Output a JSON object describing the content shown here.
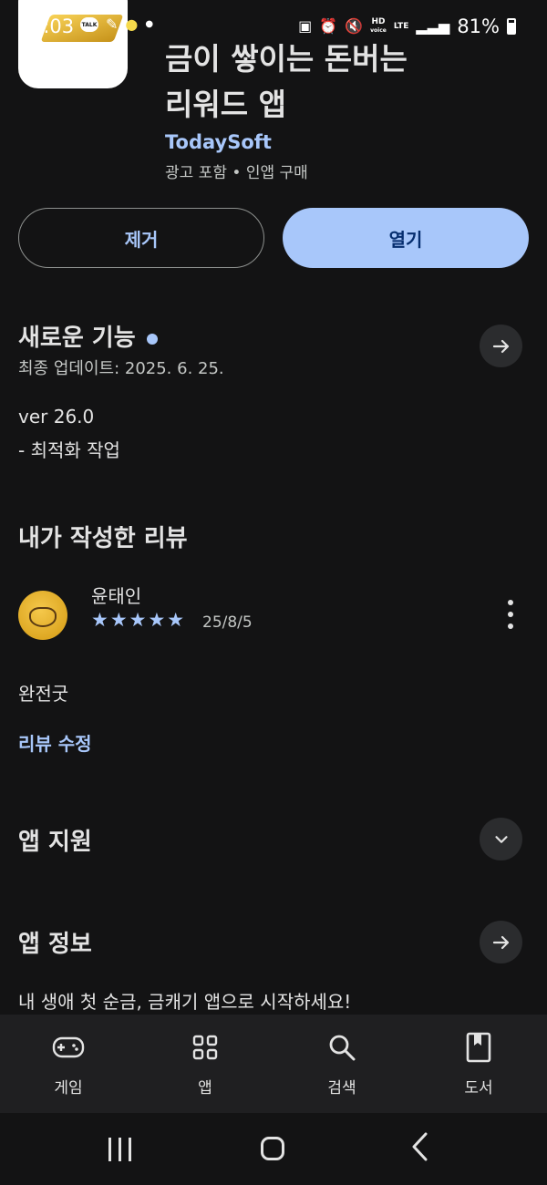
{
  "status_bar": {
    "time": "5:03",
    "talk_badge": "TALK",
    "battery": "81%",
    "network_hd": "HD",
    "network_voice": "voice",
    "network_lte": "LTE"
  },
  "app": {
    "title_line1": "금이 쌓이는 돈버는",
    "title_line2": "리워드 앱",
    "developer": "TodaySoft",
    "ads_label": "광고 포함",
    "iap_label": "인앱 구매"
  },
  "actions": {
    "remove_label": "제거",
    "open_label": "열기"
  },
  "whats_new": {
    "title": "새로운 기능",
    "updated": "최종 업데이트: 2025. 6. 25.",
    "version": "ver 26.0",
    "notes": "- 최적화 작업"
  },
  "my_review": {
    "title": "내가 작성한 리뷰",
    "reviewer": "윤태인",
    "rating": 5,
    "stars": "★★★★★",
    "date": "25/8/5",
    "text": "완전굿",
    "edit_label": "리뷰 수정"
  },
  "app_support": {
    "title": "앱 지원"
  },
  "about": {
    "title": "앱 정보",
    "description": "내 생애 첫 순금, 금캐기 앱으로 시작하세요!"
  },
  "bottom_nav": [
    {
      "label": "게임",
      "icon": "gamepad-icon"
    },
    {
      "label": "앱",
      "icon": "apps-grid-icon"
    },
    {
      "label": "검색",
      "icon": "search-icon"
    },
    {
      "label": "도서",
      "icon": "book-icon"
    }
  ],
  "colors": {
    "background": "#131314",
    "accent": "#a8c7fa",
    "open_text": "#062e6f",
    "nav_bg": "#1f1f21"
  }
}
